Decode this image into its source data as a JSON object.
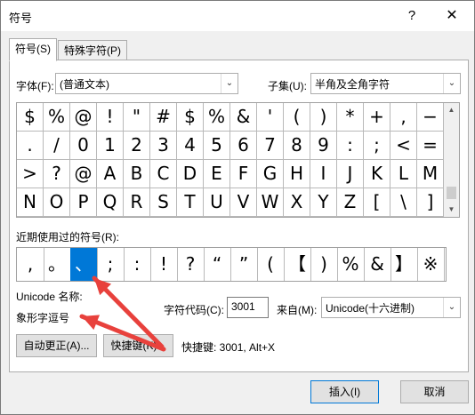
{
  "title": "符号",
  "title_help": "?",
  "title_close": "✕",
  "tabs": [
    "符号(S)",
    "特殊字符(P)"
  ],
  "font": {
    "label": "字体(F):",
    "value": "(普通文本)"
  },
  "subset": {
    "label": "子集(U):",
    "value": "半角及全角字符"
  },
  "symbols": [
    [
      "$",
      "%",
      "@",
      "!",
      "\"",
      "#",
      "$",
      "%",
      "&",
      "'",
      "(",
      ")",
      "*",
      "+",
      ",",
      "−"
    ],
    [
      ".",
      "/",
      "0",
      "1",
      "2",
      "3",
      "4",
      "5",
      "6",
      "7",
      "8",
      "9",
      ":",
      ";",
      "<",
      "="
    ],
    [
      ">",
      "?",
      "@",
      "A",
      "B",
      "C",
      "D",
      "E",
      "F",
      "G",
      "H",
      "I",
      "J",
      "K",
      "L",
      "M"
    ],
    [
      "N",
      "O",
      "P",
      "Q",
      "R",
      "S",
      "T",
      "U",
      "V",
      "W",
      "X",
      "Y",
      "Z",
      "[",
      "\\",
      "]"
    ]
  ],
  "recent": {
    "label": "近期使用过的符号(R):",
    "symbols": [
      ",",
      "。",
      "、",
      ";",
      ":",
      "!",
      "?",
      "“",
      "”",
      "(",
      "【",
      ")",
      "%",
      "&",
      "】",
      "※"
    ],
    "selected_index": 2
  },
  "unicode_name_label": "Unicode 名称:",
  "unicode_name_value": "象形字逗号",
  "char_code": {
    "label": "字符代码(C):",
    "value": "3001"
  },
  "from": {
    "label": "来自(M):",
    "value": "Unicode(十六进制)"
  },
  "buttons": {
    "autocorrect": "自动更正(A)...",
    "shortcut_key": "快捷键(K)...",
    "insert": "插入(I)",
    "cancel": "取消"
  },
  "shortcut_info": "快捷键: 3001, Alt+X",
  "scroll_icons": {
    "up": "▲",
    "down": "▼",
    "combo": "⌄"
  },
  "colors": {
    "selection": "#0078d7",
    "annotation_arrow": "#e8413c"
  }
}
